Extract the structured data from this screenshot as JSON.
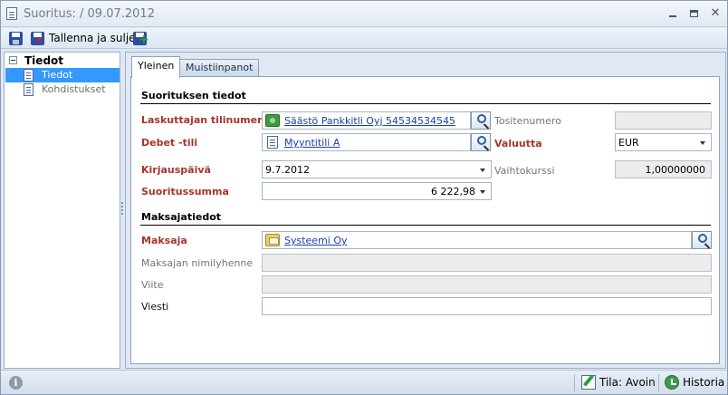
{
  "window": {
    "title": "Suoritus:  / 09.07.2012"
  },
  "toolbar": {
    "save_close_label": "Tallenna ja sulje"
  },
  "tree": {
    "root_label": "Tiedot",
    "items": [
      {
        "label": "Tiedot",
        "selected": true
      },
      {
        "label": "Kohdistukset",
        "selected": false
      }
    ]
  },
  "tabs": [
    {
      "label": "Yleinen",
      "active": true
    },
    {
      "label": "Muistiinpanot",
      "active": false
    }
  ],
  "payment_details": {
    "section_title": "Suorituksen tiedot",
    "invoicer_account_label": "Laskuttajan tilinumero",
    "invoicer_account_value": "Säästö Pankkitli Oyj 54534534545",
    "voucher_number_label": "Tositenumero",
    "voucher_number_value": "",
    "debit_account_label": "Debet -tili",
    "debit_account_value": "Myyntitili A",
    "currency_label": "Valuutta",
    "currency_value": "EUR",
    "posting_date_label": "Kirjauspäivä",
    "posting_date_value": "9.7.2012",
    "exchange_rate_label": "Vaihtokurssi",
    "exchange_rate_value": "1,00000000",
    "amount_label": "Suoritussumma",
    "amount_value": "6 222,98"
  },
  "payer_details": {
    "section_title": "Maksajatiedot",
    "payer_label": "Maksaja",
    "payer_value": "Systeemi Oy",
    "payer_abbrev_label": "Maksajan nimilyhenne",
    "payer_abbrev_value": "",
    "reference_label": "Viite",
    "reference_value": "",
    "message_label": "Viesti",
    "message_value": ""
  },
  "statusbar": {
    "state_label": "Tila: Avoin",
    "history_label": "Historia"
  }
}
